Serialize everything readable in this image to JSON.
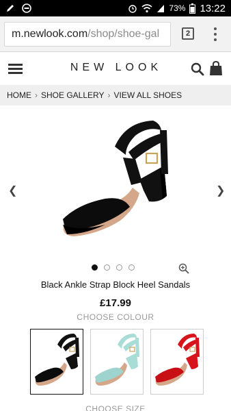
{
  "status_bar": {
    "battery_percent": "73%",
    "time": "13:22",
    "icons": [
      "pencil-icon",
      "minus-circle-icon",
      "alarm-icon",
      "wifi-icon",
      "signal-icon",
      "battery-icon"
    ]
  },
  "browser": {
    "url_host": "m.newlook.com",
    "url_path": "/shop/shoe-gal",
    "tab_count": "2"
  },
  "header": {
    "logo": "NEW LOOK",
    "icons": [
      "menu-icon",
      "search-icon",
      "shopping-bag-icon"
    ]
  },
  "breadcrumb": {
    "items": [
      "HOME",
      "SHOE GALLERY",
      "VIEW ALL SHOES"
    ]
  },
  "product": {
    "title": "Black Ankle Strap Block Heel Sandals",
    "price": "£17.99",
    "choose_colour_label": "CHOOSE COLOUR",
    "choose_size_label": "CHOOSE SIZE",
    "carousel": {
      "total_images": 4,
      "active_index": 0
    },
    "colours": [
      {
        "name": "black",
        "hex": "#111111",
        "selected": true
      },
      {
        "name": "mint",
        "hex": "#a8dcd6",
        "selected": false
      },
      {
        "name": "red",
        "hex": "#d8141b",
        "selected": false
      }
    ]
  },
  "colors": {
    "status_bar_bg": "#000000",
    "breadcrumb_bg": "#efefef",
    "muted_text": "#999999"
  }
}
